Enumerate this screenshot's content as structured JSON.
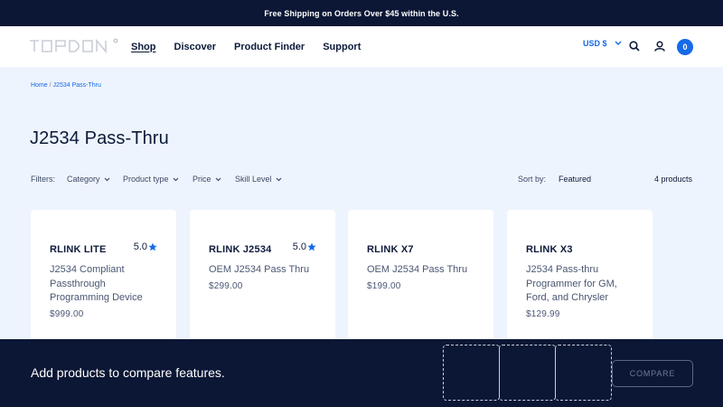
{
  "announcement": "Free Shipping on Orders Over $45 within the U.S.",
  "logo": {
    "alt": "TOPDON"
  },
  "nav": [
    {
      "label": "Shop",
      "active": true
    },
    {
      "label": "Discover",
      "active": false
    },
    {
      "label": "Product Finder",
      "active": false
    },
    {
      "label": "Support",
      "active": false
    }
  ],
  "currency": "USD $",
  "icons": {
    "search": "search-icon",
    "account": "user-icon",
    "chevron": "chevron-down-icon",
    "star": "star-icon"
  },
  "cart_count": "0",
  "breadcrumb": {
    "home": "Home",
    "separator": "/",
    "current": "J2534 Pass-Thru"
  },
  "page_title": "J2534 Pass-Thru",
  "filters": {
    "label": "Filters:",
    "items": [
      "Category",
      "Product type",
      "Price",
      "Skill Level"
    ],
    "sort_label": "Sort by:",
    "sort_value": "Featured",
    "count": "4 products"
  },
  "products": [
    {
      "name": "RLINK LITE",
      "rating": "5.0",
      "description": "J2534 Compliant Passthrough Programming Device",
      "price": "$999.00"
    },
    {
      "name": "RLINK J2534",
      "rating": "5.0",
      "description": "OEM J2534 Pass Thru",
      "price": "$299.00"
    },
    {
      "name": "RLINK X7",
      "rating": "",
      "description": "OEM J2534 Pass Thru",
      "price": "$199.00"
    },
    {
      "name": "RLINK X3",
      "rating": "",
      "description": "J2534 Pass-thru Programmer for GM, Ford, and Chrysler",
      "price": "$129.99"
    }
  ],
  "compare": {
    "text": "Add products to compare features.",
    "button": "COMPARE"
  },
  "colors": {
    "navy": "#0b1735",
    "accent": "#1669e8",
    "background": "#eef4fd"
  }
}
